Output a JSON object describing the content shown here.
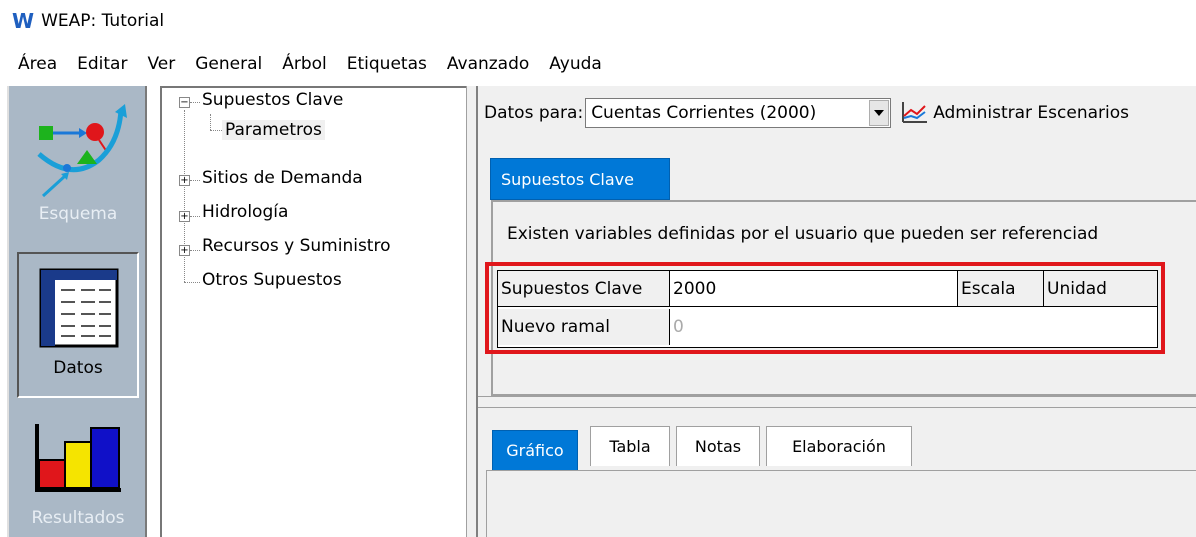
{
  "window": {
    "logo": "W",
    "title": "WEAP: Tutorial"
  },
  "menu": [
    "Área",
    "Editar",
    "Ver",
    "General",
    "Árbol",
    "Etiquetas",
    "Avanzado",
    "Ayuda"
  ],
  "views": {
    "esquema": {
      "label": "Esquema",
      "icon": "schematic-icon"
    },
    "datos": {
      "label": "Datos",
      "icon": "data-table-icon"
    },
    "resultados": {
      "label": "Resultados",
      "icon": "bar-chart-icon"
    }
  },
  "tree": {
    "nodes": [
      {
        "label": "Supuestos Clave",
        "expander": "−"
      },
      {
        "label": "Parametros"
      },
      {
        "label": "Sitios de Demanda",
        "expander": "+"
      },
      {
        "label": "Hidrología",
        "expander": "+"
      },
      {
        "label": "Recursos y Suministro",
        "expander": "+"
      },
      {
        "label": "Otros Supuestos"
      }
    ]
  },
  "datos_para": {
    "label": "Datos para:",
    "selected": "Cuentas Corrientes (2000)",
    "manage_label": "Administrar Escenarios"
  },
  "top_tab": {
    "label": "Supuestos Clave"
  },
  "info_text": "Existen variables definidas por el usuario que pueden ser referenciad",
  "grid": {
    "headers": [
      "Supuestos Clave",
      "2000",
      "Escala",
      "Unidad"
    ],
    "row": {
      "name": "Nuevo ramal",
      "value": "0"
    }
  },
  "bottom_tabs": [
    "Gráfico",
    "Tabla",
    "Notas",
    "Elaboración"
  ],
  "colors": {
    "accent": "#0078d7",
    "highlight": "#e0161b",
    "viewbar": "#aab8c6"
  }
}
